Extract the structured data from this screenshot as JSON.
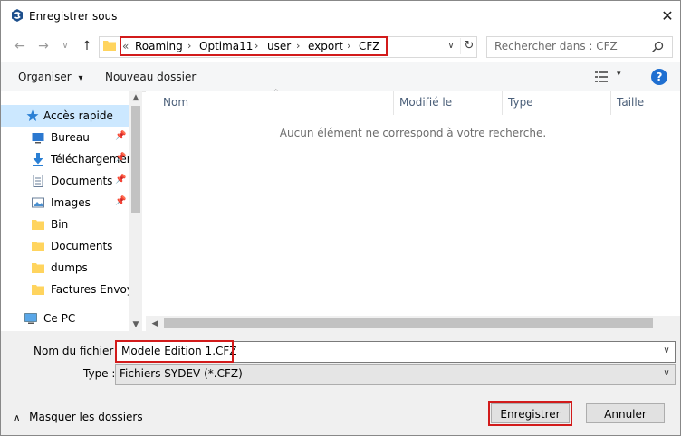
{
  "window": {
    "title": "Enregistrer sous",
    "close_glyph": "✕"
  },
  "nav": {
    "back": "←",
    "forward": "→",
    "down": "∨",
    "up": "↑"
  },
  "address": {
    "overflow": "«",
    "crumbs": [
      "Roaming",
      "Optima11",
      "user",
      "export",
      "CFZ"
    ],
    "separator": "›",
    "dropdown": "∨",
    "refresh": "↻"
  },
  "search": {
    "placeholder": "Rechercher dans : CFZ"
  },
  "toolbar": {
    "organize": "Organiser",
    "organize_caret": "▾",
    "new_folder": "Nouveau dossier",
    "view_caret": "▾",
    "help": "?"
  },
  "sidebar": {
    "items": [
      {
        "label": "Accès rapide",
        "icon": "star-icon",
        "selected": true,
        "pinned": false
      },
      {
        "label": "Bureau",
        "icon": "desktop-icon",
        "selected": false,
        "pinned": true
      },
      {
        "label": "Téléchargements",
        "icon": "download-icon",
        "selected": false,
        "pinned": true
      },
      {
        "label": "Documents",
        "icon": "documents-icon",
        "selected": false,
        "pinned": true
      },
      {
        "label": "Images",
        "icon": "images-icon",
        "selected": false,
        "pinned": true
      },
      {
        "label": "Bin",
        "icon": "folder-icon",
        "selected": false,
        "pinned": false
      },
      {
        "label": "Documents",
        "icon": "folder-icon",
        "selected": false,
        "pinned": false
      },
      {
        "label": "dumps",
        "icon": "folder-icon",
        "selected": false,
        "pinned": false
      },
      {
        "label": "Factures Envoyees",
        "icon": "folder-icon",
        "selected": false,
        "pinned": false
      },
      {
        "label": "Ce PC",
        "icon": "computer-icon",
        "selected": false,
        "pinned": false
      }
    ]
  },
  "columns": [
    "Nom",
    "Modifié le",
    "Type",
    "Taille"
  ],
  "empty_message": "Aucun élément ne correspond à votre recherche.",
  "form": {
    "filename_label": "Nom du fichier :",
    "filename_value": "Modele Edition 1.CFZ",
    "type_label": "Type :",
    "type_value": "Fichiers SYDEV (*.CFZ)"
  },
  "footer": {
    "hide_folders": "Masquer les dossiers",
    "hide_caret": "∧",
    "save": "Enregistrer",
    "cancel": "Annuler"
  },
  "colors": {
    "accent": "#1f6fd1",
    "highlight": "#d21b1b",
    "selection": "#cce8ff"
  }
}
